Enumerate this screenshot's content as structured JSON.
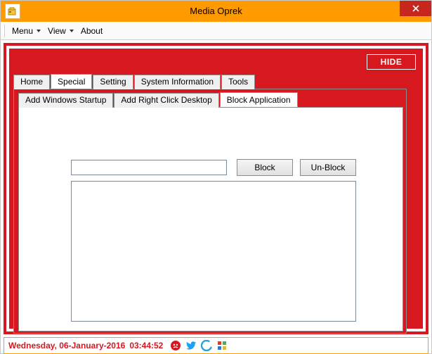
{
  "window": {
    "title": "Media Oprek"
  },
  "menubar": {
    "menu": "Menu",
    "view": "View",
    "about": "About"
  },
  "hide_button": "HIDE",
  "tabs_main": {
    "home": "Home",
    "special": "Special",
    "setting": "Setting",
    "sysinfo": "System Information",
    "tools": "Tools",
    "active": "special"
  },
  "tabs_special": {
    "addstartup": "Add Windows Startup",
    "addright": "Add Right Click Desktop",
    "blockapp": "Block Application",
    "active": "blockapp"
  },
  "block_panel": {
    "input_value": "",
    "block_btn": "Block",
    "unblock_btn": "Un-Block"
  },
  "status": {
    "date": "Wednesday, 06-January-2016",
    "time": "03:44:52"
  }
}
